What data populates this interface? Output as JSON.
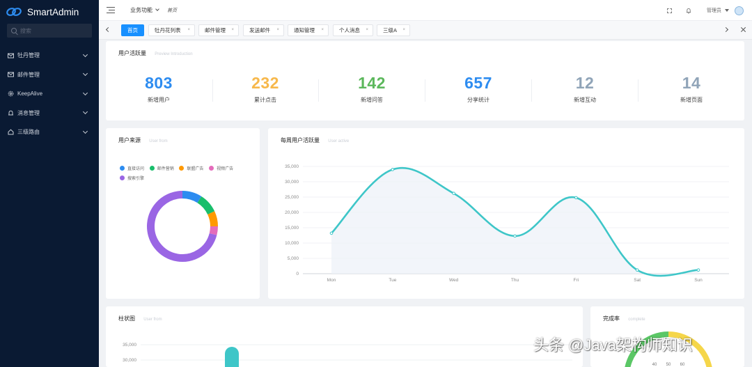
{
  "app": {
    "name": "SmartAdmin"
  },
  "sidebar": {
    "search_placeholder": "搜索",
    "items": [
      {
        "label": "牡丹管理",
        "icon": "mail-icon"
      },
      {
        "label": "邮件管理",
        "icon": "mail-icon"
      },
      {
        "label": "KeepAlive",
        "icon": "gear-icon"
      },
      {
        "label": "消息管理",
        "icon": "bell-icon"
      },
      {
        "label": "三级路由",
        "icon": "home-icon"
      }
    ]
  },
  "header": {
    "menu_label": "业务功能",
    "breadcrumb": "首页",
    "user": "管理员"
  },
  "tabs": [
    "首页",
    "牡丹花列表",
    "邮件管理",
    "发送邮件",
    "通知管理",
    "个人消息",
    "三级A"
  ],
  "activity": {
    "title": "用户活跃量",
    "subtitle": "Preview Introduction",
    "stats": [
      {
        "value": "803",
        "label": "新增用户",
        "color": "#2d8cf0"
      },
      {
        "value": "232",
        "label": "累计点击",
        "color": "#f7b84b"
      },
      {
        "value": "142",
        "label": "新增问答",
        "color": "#5cb85c"
      },
      {
        "value": "657",
        "label": "分享统计",
        "color": "#2d8cf0"
      },
      {
        "value": "12",
        "label": "新增互动",
        "color": "#90a4b8"
      },
      {
        "value": "14",
        "label": "新增页面",
        "color": "#90a4b8"
      }
    ]
  },
  "user_source": {
    "title": "用户来源",
    "subtitle": "User from",
    "legend": [
      {
        "label": "直接访问",
        "color": "#2d8cf0"
      },
      {
        "label": "邮件营销",
        "color": "#19be6b"
      },
      {
        "label": "联盟广告",
        "color": "#ff9900"
      },
      {
        "label": "视频广告",
        "color": "#e46cbb"
      },
      {
        "label": "搜索引擎",
        "color": "#9a66e4"
      }
    ],
    "chart_data": {
      "type": "pie",
      "labels": [
        "直接访问",
        "邮件营销",
        "联盟广告",
        "视频广告",
        "搜索引擎"
      ],
      "values": [
        9,
        9,
        7,
        4,
        71
      ]
    }
  },
  "weekly": {
    "title": "每周用户活跃量",
    "subtitle": "User active",
    "chart_data": {
      "type": "line",
      "x": [
        "Mon",
        "Tue",
        "Wed",
        "Thu",
        "Fri",
        "Sat",
        "Sun"
      ],
      "values": [
        13200,
        34000,
        26200,
        12300,
        24800,
        1200,
        1200
      ],
      "ylim": [
        0,
        35000
      ],
      "yticks": [
        "0",
        "5,000",
        "10,000",
        "15,000",
        "20,000",
        "25,000",
        "30,000",
        "35,000"
      ],
      "grid": true,
      "color": "#3ec6c8"
    }
  },
  "bar_card": {
    "title": "柱状图",
    "subtitle": "User from",
    "yticks": [
      "35,000",
      "30,000"
    ]
  },
  "completion": {
    "title": "完成率",
    "subtitle": "complete",
    "gauge_labels": [
      "40",
      "50",
      "60"
    ]
  },
  "watermark": "头条 @Java架构师知识"
}
